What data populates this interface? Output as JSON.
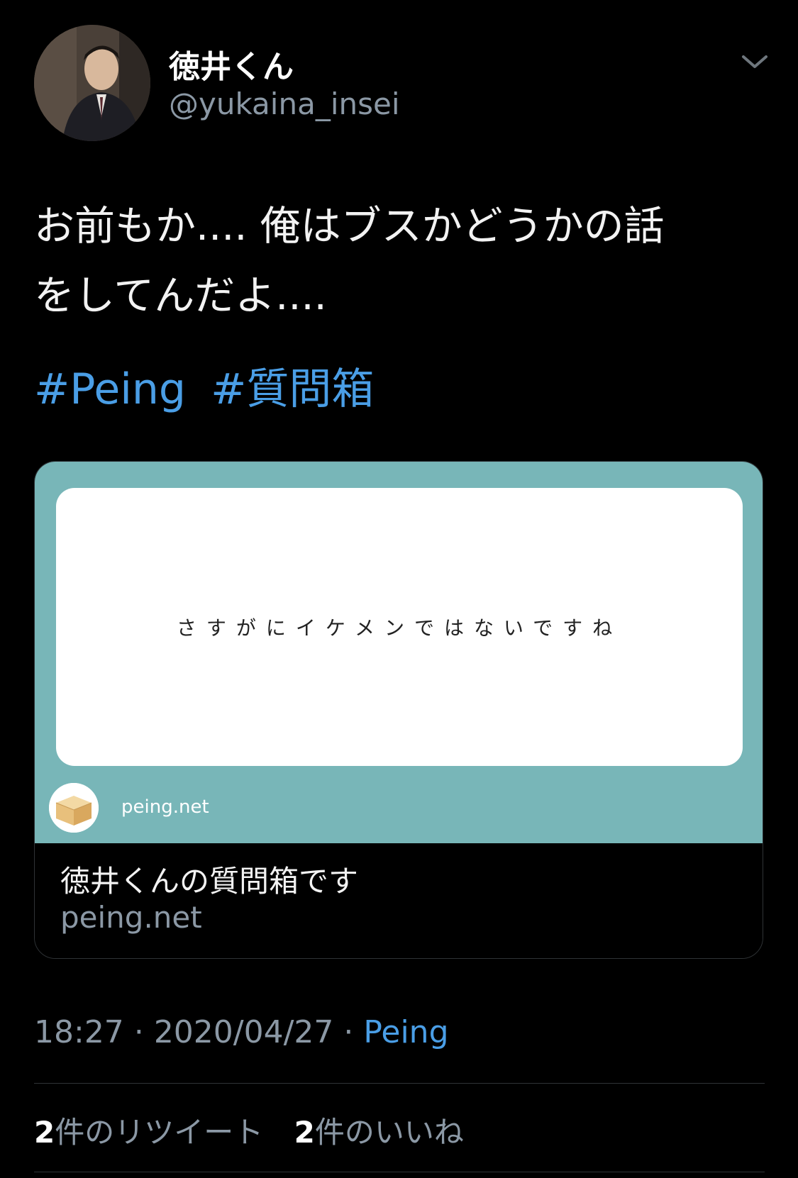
{
  "author": {
    "display_name": "徳井くん",
    "handle": "@yukaina_insei"
  },
  "tweet": {
    "line1": "お前もか.... 俺はブスかどうかの話",
    "line2": "をしてんだよ....",
    "hashtags": [
      "#Peing",
      "#質問箱"
    ]
  },
  "card": {
    "question": "さすがにイケメンではないですね",
    "brand_label": "peing.net",
    "title": "徳井くんの質問箱です",
    "domain": "peing.net",
    "background_color": "#78b6b8"
  },
  "meta": {
    "time": "18:27",
    "date": "2020/04/27",
    "separator": "·",
    "source": "Peing"
  },
  "stats": {
    "retweets_count": "2",
    "retweets_label": "件のリツイート",
    "likes_count": "2",
    "likes_label": "件のいいね"
  },
  "colors": {
    "background": "#000000",
    "link": "#4a9ee6",
    "muted": "#8b98a5"
  },
  "icons": {
    "menu": "chevron-down-icon",
    "card_logo": "cardboard-box-icon"
  }
}
